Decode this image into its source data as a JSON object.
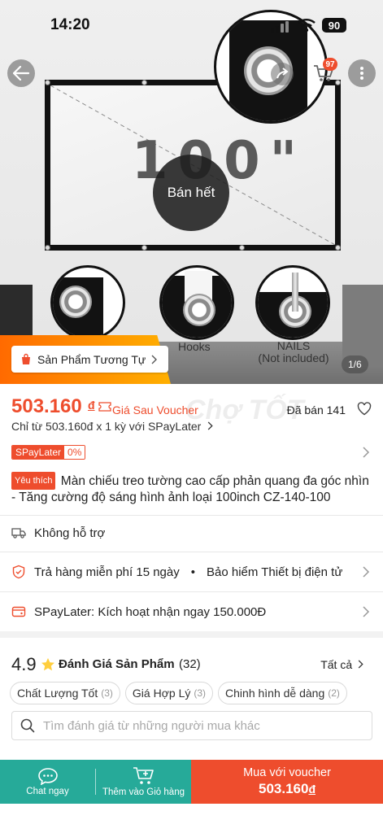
{
  "status_bar": {
    "time": "14:20",
    "battery": "90"
  },
  "top_nav": {
    "cart_badge": "97"
  },
  "hero": {
    "size_text": "100\"",
    "sold_out": "Bán hết",
    "hooks_label": "Hooks",
    "nails_label_1": "NAILS",
    "nails_label_2": "(Not included)",
    "similar_button": "Sản Phẩm Tương Tự",
    "image_counter": "1/6"
  },
  "price": {
    "amount": "503.160",
    "currency": "đ",
    "after_voucher": "Giá Sau Voucher",
    "sold": "Đã bán 141",
    "installment": "Chỉ từ 503.160đ x 1 kỳ với SPayLater",
    "watermark": "Chợ TỐT"
  },
  "spaylater_tag": {
    "name": "SPayLater",
    "rate": "0%"
  },
  "product": {
    "favorite_tag": "Yêu thích",
    "title": "Màn chiếu treo tường cao cấp phản quang đa góc nhìn - Tăng cường độ sáng hình ảnh loại 100inch CZ-140-100"
  },
  "shipping": {
    "text": "Không hỗ trợ"
  },
  "guarantee": {
    "return": "Trả hàng miễn phí 15 ngày",
    "separator": "•",
    "insurance": "Bảo hiểm Thiết bị điện tử"
  },
  "spaylater_promo": {
    "text": "SPayLater: Kích hoạt nhận ngay 150.000Đ"
  },
  "reviews": {
    "score": "4.9",
    "title": "Đánh Giá Sản Phẩm",
    "count": "(32)",
    "see_all": "Tất cả",
    "chips": [
      {
        "label": "Chất Lượng Tốt",
        "count": "(3)"
      },
      {
        "label": "Giá Hợp Lý",
        "count": "(3)"
      },
      {
        "label": "Chinh hình dễ dàng",
        "count": "(2)"
      }
    ],
    "search_placeholder": "Tìm đánh giá từ những người mua khác"
  },
  "bottom_bar": {
    "chat": "Chat ngay",
    "add_to_cart": "Thêm vào Giỏ hàng",
    "buy_line1": "Mua với voucher",
    "buy_price": "503.160",
    "buy_currency": "đ"
  },
  "colors": {
    "accent": "#ee4d2d",
    "chat_green": "#26aa99",
    "star": "#ffce3d"
  }
}
